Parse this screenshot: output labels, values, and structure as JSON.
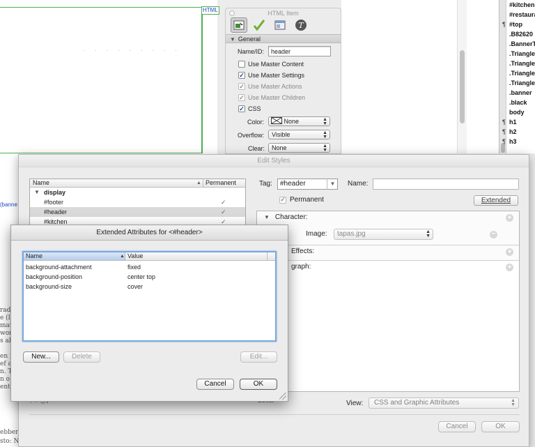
{
  "canvas": {
    "html_tag": "HTML",
    "banner_link": "(banne",
    "hand_lines": [
      "radit",
      "e (la",
      "matic",
      "wor",
      "s al",
      "",
      "en i",
      "ef a",
      "n. T",
      "n o",
      "enta"
    ],
    "bottom_lines": [
      "ebber",
      "sto: N"
    ]
  },
  "style_list": {
    "items": [
      {
        "label": "#kitchen",
        "para": false
      },
      {
        "label": "#restaura",
        "para": false
      },
      {
        "label": "#top",
        "para": true
      },
      {
        "label": ".B82620",
        "para": false
      },
      {
        "label": ".BannerT",
        "para": false
      },
      {
        "label": ".Triangle",
        "para": false
      },
      {
        "label": ".Triangle",
        "para": false
      },
      {
        "label": ".Triangle",
        "para": false
      },
      {
        "label": ".Triangle",
        "para": false
      },
      {
        "label": ".banner",
        "para": false
      },
      {
        "label": ".black",
        "para": false
      },
      {
        "label": "body",
        "para": false
      },
      {
        "label": "h1",
        "para": true
      },
      {
        "label": "h2",
        "para": true
      },
      {
        "label": "h3",
        "para": true
      }
    ]
  },
  "inspector": {
    "title": "HTML Item",
    "section": "General",
    "name_label": "Name/ID:",
    "name_value": "header",
    "checks": [
      {
        "label": "Use Master Content",
        "checked": false,
        "dim": false
      },
      {
        "label": "Use Master Settings",
        "checked": true,
        "dim": false
      },
      {
        "label": "Use Master Actions",
        "checked": true,
        "dim": true
      },
      {
        "label": "Use Master Children",
        "checked": true,
        "dim": true
      },
      {
        "label": "CSS",
        "checked": true,
        "dim": false
      }
    ],
    "color_label": "Color:",
    "color_value": "None",
    "overflow_label": "Overflow:",
    "overflow_value": "Visible",
    "clear_label": "Clear:",
    "clear_value": "None"
  },
  "edit_styles": {
    "title": "Edit Styles",
    "list_headers": {
      "name": "Name",
      "permanent": "Permanent"
    },
    "rows": [
      {
        "label": "display",
        "group": true,
        "checked": false
      },
      {
        "label": "#footer",
        "group": false,
        "checked": true
      },
      {
        "label": "#header",
        "group": false,
        "checked": true,
        "selected": true
      },
      {
        "label": "#kitchen",
        "group": false,
        "checked": true
      }
    ],
    "tag_label": "Tag:",
    "tag_value": "#header",
    "name_label": "Name:",
    "permanent_label": "Permanent",
    "extended_button": "Extended",
    "sections": {
      "character": "Character:",
      "image_label": "Image:",
      "image_value": "tapas.jpg",
      "effects": "Effects:",
      "paragraph": "graph:"
    },
    "select_label": "Select",
    "view_label": "View:",
    "view_value": "CSS and Graphic Attributes",
    "cancel": "Cancel",
    "ok": "OK"
  },
  "extended": {
    "title": "Extended Attributes for <#header>",
    "headers": {
      "name": "Name",
      "value": "Value"
    },
    "rows": [
      {
        "name": "background-attachment",
        "value": "fixed"
      },
      {
        "name": "background-position",
        "value": "center top"
      },
      {
        "name": "background-size",
        "value": "cover"
      }
    ],
    "new_button": "New...",
    "delete_button": "Delete",
    "edit_button": "Edit...",
    "cancel_button": "Cancel",
    "ok_button": "OK"
  }
}
